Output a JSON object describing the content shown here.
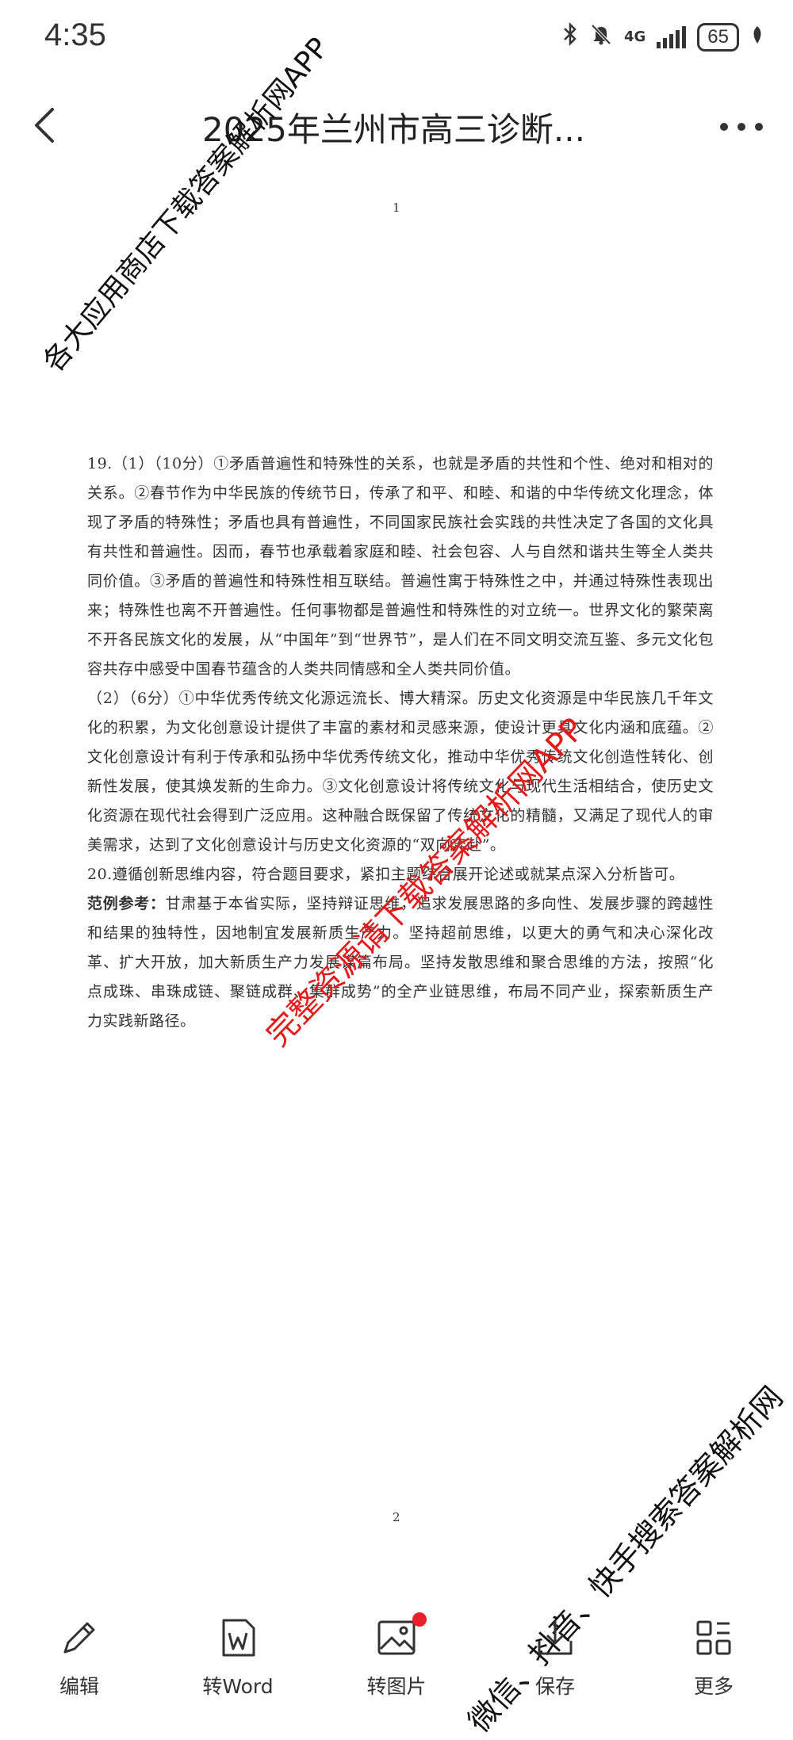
{
  "status_bar": {
    "time": "4:35",
    "network": "4G",
    "battery": "65"
  },
  "header": {
    "title": "2025年兰州市高三诊断..."
  },
  "document": {
    "page_numbers": [
      "1",
      "2"
    ],
    "q19_p1": "19.（1）（10分）①矛盾普遍性和特殊性的关系，也就是矛盾的共性和个性、绝对和相对的关系。②春节作为中华民族的传统节日，传承了和平、和睦、和谐的中华传统文化理念，体现了矛盾的特殊性；矛盾也具有普遍性，不同国家民族社会实践的共性决定了各国的文化具有共性和普遍性。因而，春节也承载着家庭和睦、社会包容、人与自然和谐共生等全人类共同价值。③矛盾的普遍性和特殊性相互联结。普遍性寓于特殊性之中，并通过特殊性表现出来；特殊性也离不开普遍性。任何事物都是普遍性和特殊性的对立统一。世界文化的繁荣离不开各民族文化的发展，从“中国年”到“世界节”，是人们在不同文明交流互鉴、多元文化包容共存中感受中国春节蕴含的人类共同情感和全人类共同价值。",
    "q19_p2": "（2）（6分）①中华优秀传统文化源远流长、博大精深。历史文化资源是中华民族几千年文化的积累，为文化创意设计提供了丰富的素材和灵感来源，使设计更具文化内涵和底蕴。②文化创意设计有利于传承和弘扬中华优秀传统文化，推动中华优秀传统文化创造性转化、创新性发展，使其焕发新的生命力。③文化创意设计将传统文化与现代生活相结合，使历史文化资源在现代社会得到广泛应用。这种融合既保留了传统文化的精髓，又满足了现代人的审美需求，达到了文化创意设计与历史文化资源的“双向奔赴”。",
    "q20": "20.遵循创新思维内容，符合题目要求，紧扣主题综合展开论述或就某点深入分析皆可。",
    "example_label": "范例参考：",
    "example_text": "甘肃基于本省实际，坚持辩证思维，追求发展思路的多向性、发展步骤的跨越性和结果的独特性，因地制宜发展新质生产力。坚持超前思维，以更大的勇气和决心深化改革、扩大开放，加大新质生产力发展谋篇布局。坚持发散思维和聚合思维的方法，按照“化点成珠、串珠成链、聚链成群、集群成势”的全产业链思维，布局不同产业，探索新质生产力实践新路径。"
  },
  "watermarks": [
    "各大应用商店下载答案解析网APP",
    "完整资源请下载答案解析网APP",
    "微信、抖音、快手搜索答案解析网"
  ],
  "toolbar": {
    "edit": "编辑",
    "to_word": "转Word",
    "to_image": "转图片",
    "save": "保存",
    "more": "更多"
  }
}
